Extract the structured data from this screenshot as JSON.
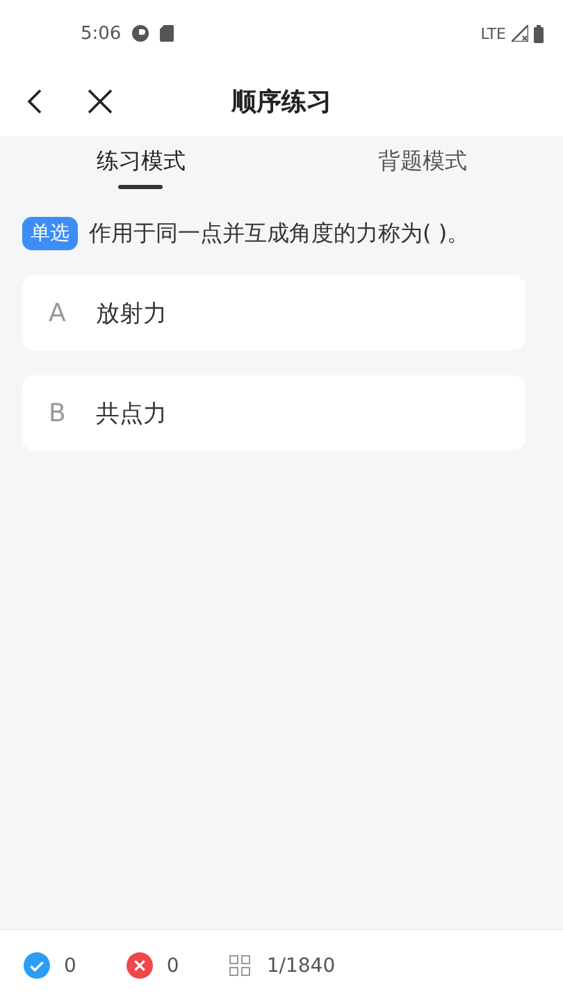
{
  "status_bar": {
    "time": "5:06",
    "network": "LTE"
  },
  "header": {
    "title": "顺序练习"
  },
  "tabs": [
    {
      "label": "练习模式",
      "selected": true
    },
    {
      "label": "背题模式",
      "selected": false
    }
  ],
  "question": {
    "type": "单选",
    "text": "作用于同一点并互成角度的力称为( )。"
  },
  "options": [
    {
      "letter": "A",
      "text": "放射力",
      "selected": false
    },
    {
      "letter": "B",
      "text": "共点力",
      "selected": false
    }
  ],
  "bottom_bar": {
    "correct": "0",
    "wrong": "0",
    "progress": "1/1840"
  }
}
